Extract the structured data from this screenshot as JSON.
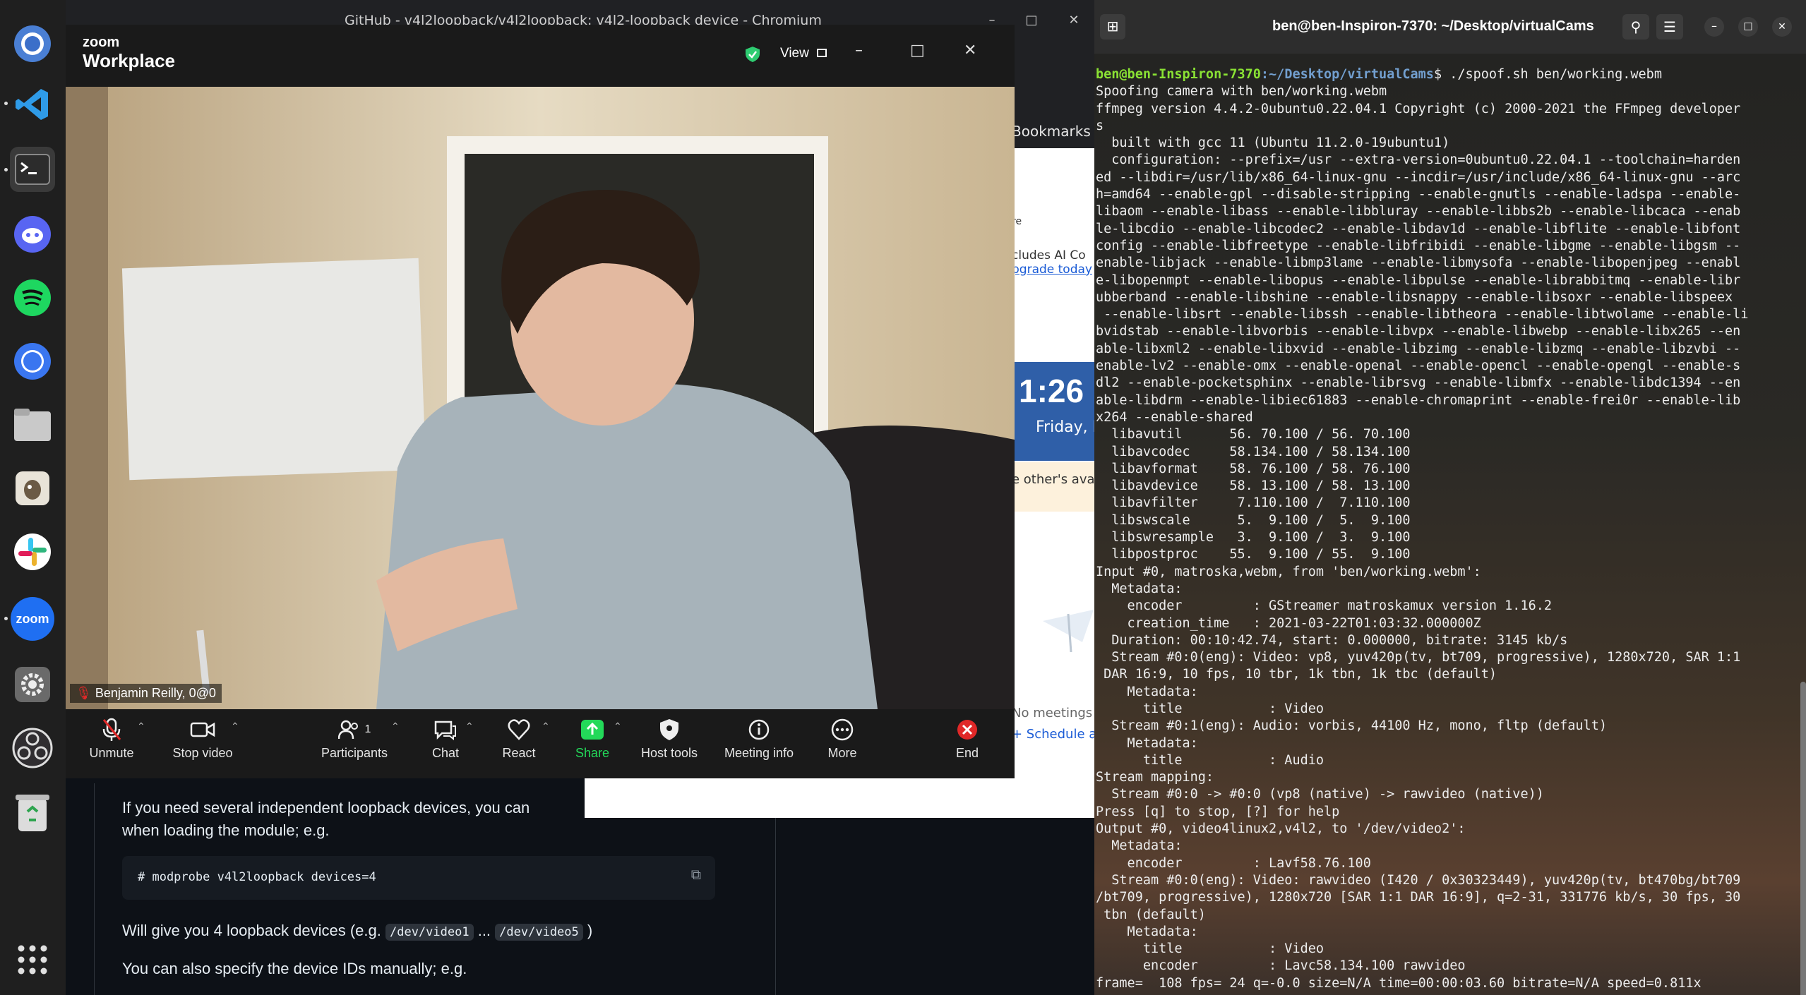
{
  "dock": {
    "items": [
      {
        "name": "chromium",
        "icon": "chromium-icon"
      },
      {
        "name": "vscode",
        "icon": "vscode-icon"
      },
      {
        "name": "terminal",
        "icon": "terminal-icon"
      },
      {
        "name": "discord",
        "icon": "discord-icon"
      },
      {
        "name": "spotify",
        "icon": "spotify-icon"
      },
      {
        "name": "signal",
        "icon": "signal-icon"
      },
      {
        "name": "files",
        "icon": "folder-icon"
      },
      {
        "name": "gimp",
        "icon": "gimp-icon"
      },
      {
        "name": "slack",
        "icon": "slack-icon"
      },
      {
        "name": "zoom",
        "icon": "zoom-icon",
        "label": "zoom"
      },
      {
        "name": "settings",
        "icon": "gear-icon"
      },
      {
        "name": "obs",
        "icon": "obs-icon"
      },
      {
        "name": "trash",
        "icon": "trash-icon"
      },
      {
        "name": "app-grid",
        "icon": "app-grid-icon"
      }
    ]
  },
  "browser": {
    "title": "GitHub - v4l2loopback/v4l2loopback: v4l2-loopback device - Chromium",
    "bookmarks_label": "Bookmarks",
    "strip": {
      "re": "re",
      "includes": "cludes AI Co",
      "upgrade": "pgrade today",
      "time": "1:26",
      "day": "Friday, M",
      "others_available": "e other's availa",
      "no_meetings": "No meetings sch",
      "schedule": "+ Schedule a me"
    },
    "readme": {
      "para1_a": "If you need several independent loopback devices, you can",
      "para1_b": "when loading the module; e.g.",
      "code1": "# modprobe v4l2loopback devices=4",
      "para2_a": "Will give you 4 loopback devices (e.g.",
      "para2_code1": "/dev/video1",
      "para2_dots": "...",
      "para2_code2": "/dev/video5",
      "para2_b": ")",
      "para3": "You can also specify the device IDs manually; e.g."
    }
  },
  "zoom": {
    "brand_top": "zoom",
    "brand_bottom": "Workplace",
    "view_label": "View",
    "participant_name": "Benjamin Reilly, 0@0",
    "participants_count": "1",
    "controls": {
      "unmute": "Unmute",
      "stop_video": "Stop video",
      "participants": "Participants",
      "chat": "Chat",
      "react": "React",
      "share": "Share",
      "host_tools": "Host tools",
      "meeting_info": "Meeting info",
      "more": "More",
      "end": "End"
    },
    "colors": {
      "share_green": "#23d959",
      "end_red": "#e02828",
      "shield_green": "#2ecc71"
    }
  },
  "terminal": {
    "title": "ben@ben-Inspiron-7370: ~/Desktop/virtualCams",
    "prompt_user": "ben@ben-Inspiron-7370",
    "prompt_path": ":~/Desktop/virtualCams",
    "prompt_cmd": "$ ./spoof.sh ben/working.webm",
    "output": "Spoofing camera with ben/working.webm\nffmpeg version 4.4.2-0ubuntu0.22.04.1 Copyright (c) 2000-2021 the FFmpeg developer\ns\n  built with gcc 11 (Ubuntu 11.2.0-19ubuntu1)\n  configuration: --prefix=/usr --extra-version=0ubuntu0.22.04.1 --toolchain=harden\ned --libdir=/usr/lib/x86_64-linux-gnu --incdir=/usr/include/x86_64-linux-gnu --arc\nh=amd64 --enable-gpl --disable-stripping --enable-gnutls --enable-ladspa --enable-\nlibaom --enable-libass --enable-libbluray --enable-libbs2b --enable-libcaca --enab\nle-libcdio --enable-libcodec2 --enable-libdav1d --enable-libflite --enable-libfont\nconfig --enable-libfreetype --enable-libfribidi --enable-libgme --enable-libgsm --\nenable-libjack --enable-libmp3lame --enable-libmysofa --enable-libopenjpeg --enabl\ne-libopenmpt --enable-libopus --enable-libpulse --enable-librabbitmq --enable-libr\nubberband --enable-libshine --enable-libsnappy --enable-libsoxr --enable-libspeex\n --enable-libsrt --enable-libssh --enable-libtheora --enable-libtwolame --enable-li\nbvidstab --enable-libvorbis --enable-libvpx --enable-libwebp --enable-libx265 --en\nable-libxml2 --enable-libxvid --enable-libzimg --enable-libzmq --enable-libzvbi --\nenable-lv2 --enable-omx --enable-openal --enable-opencl --enable-opengl --enable-s\ndl2 --enable-pocketsphinx --enable-librsvg --enable-libmfx --enable-libdc1394 --en\nable-libdrm --enable-libiec61883 --enable-chromaprint --enable-frei0r --enable-lib\nx264 --enable-shared\n  libavutil      56. 70.100 / 56. 70.100\n  libavcodec     58.134.100 / 58.134.100\n  libavformat    58. 76.100 / 58. 76.100\n  libavdevice    58. 13.100 / 58. 13.100\n  libavfilter     7.110.100 /  7.110.100\n  libswscale      5.  9.100 /  5.  9.100\n  libswresample   3.  9.100 /  3.  9.100\n  libpostproc    55.  9.100 / 55.  9.100\nInput #0, matroska,webm, from 'ben/working.webm':\n  Metadata:\n    encoder         : GStreamer matroskamux version 1.16.2\n    creation_time   : 2021-03-22T01:03:32.000000Z\n  Duration: 00:10:42.74, start: 0.000000, bitrate: 3145 kb/s\n  Stream #0:0(eng): Video: vp8, yuv420p(tv, bt709, progressive), 1280x720, SAR 1:1\n DAR 16:9, 10 fps, 10 tbr, 1k tbn, 1k tbc (default)\n    Metadata:\n      title           : Video\n  Stream #0:1(eng): Audio: vorbis, 44100 Hz, mono, fltp (default)\n    Metadata:\n      title           : Audio\nStream mapping:\n  Stream #0:0 -> #0:0 (vp8 (native) -> rawvideo (native))\nPress [q] to stop, [?] for help\nOutput #0, video4linux2,v4l2, to '/dev/video2':\n  Metadata:\n    encoder         : Lavf58.76.100\n  Stream #0:0(eng): Video: rawvideo (I420 / 0x30323449), yuv420p(tv, bt470bg/bt709\n/bt709, progressive), 1280x720 [SAR 1:1 DAR 16:9], q=2-31, 331776 kb/s, 30 fps, 30\n tbn (default)\n    Metadata:\n      title           : Video\n      encoder         : Lavc58.134.100 rawvideo\nframe=  108 fps= 24 q=-0.0 size=N/A time=00:00:03.60 bitrate=N/A speed=0.811x"
  }
}
